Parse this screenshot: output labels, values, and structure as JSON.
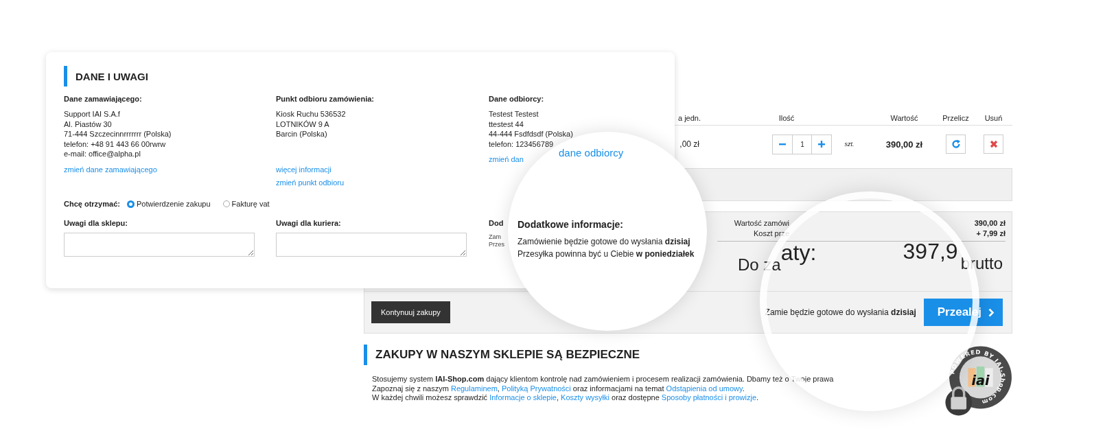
{
  "order_details": {
    "title": "DANE I UWAGI",
    "columns": [
      {
        "heading": "Dane zamawiającego:",
        "lines": [
          "Support IAI S.A.f",
          "Al. Piastów 30",
          "71-444 Szczecinnrrrrrrr (Polska)",
          "telefon: +48 91 443 66 00rwrw",
          "e-mail: office@alpha.pl"
        ],
        "links": [
          "zmień dane zamawiającego"
        ]
      },
      {
        "heading": "Punkt odbioru zamówienia:",
        "lines": [
          "Kiosk Ruchu 536532",
          "LOTNIKÓW 9 A",
          "Barcin (Polska)"
        ],
        "links": [
          "więcej informacji",
          "zmień punkt odbioru"
        ]
      },
      {
        "heading": "Dane odbiorcy:",
        "lines": [
          "Testest Testest",
          "ttestest 44",
          "44-444 Fsdfdsdf (Polska)",
          "telefon: 123456789"
        ],
        "links": [
          "zmień dan"
        ]
      }
    ],
    "receive": {
      "label": "Chcę otrzymać:",
      "options": [
        {
          "label": "Potwierdzenie zakupu",
          "selected": true
        },
        {
          "label": "Fakturę vat",
          "selected": false
        }
      ]
    },
    "notes": [
      {
        "label": "Uwagi dla sklepu:"
      },
      {
        "label": "Uwagi dla kuriera:"
      }
    ],
    "extra": {
      "heading": "Dod",
      "lines": [
        "Zam",
        "Przes"
      ]
    }
  },
  "cart": {
    "columns": [
      "a jedn.",
      "Ilość",
      "Wartość",
      "Przelicz",
      "Usuń"
    ],
    "row": {
      "unit_price": ",00 zł",
      "quantity": "1",
      "unit": "szt.",
      "value": "390,00 zł"
    }
  },
  "summary": {
    "rows": [
      {
        "label": "Wartość zamówi",
        "value": "390,00 zł"
      },
      {
        "label": "Koszt prze",
        "value": "+ 7,99 zł"
      }
    ],
    "total_label": [
      "Do za",
      "aty:"
    ],
    "total_value": "397,9",
    "total_suffix": "brutto"
  },
  "actions": {
    "continue": "Kontynuuj zakupy",
    "ready_note": "Zamie będzie gotowe do wysłania **dzisiaj**",
    "next": "Przealej"
  },
  "security": {
    "title": "ZAKUPY W NASZYM SKLEPIE SĄ BEZPIECZNE",
    "lines": [
      [
        {
          "kind": "text",
          "text": "Stosujemy system **IAI-Shop.com** dający klientom kontrolę nad zamówieniem i procesem realizacji zamówienia. Dbamy też o Twoje prawa"
        }
      ],
      [
        {
          "kind": "text",
          "text": "Zapoznaj się z naszym "
        },
        {
          "kind": "link",
          "text": "Regulaminem"
        },
        {
          "kind": "text",
          "text": ", "
        },
        {
          "kind": "link",
          "text": "Polityką Prywatności"
        },
        {
          "kind": "text",
          "text": " oraz informacjami na temat "
        },
        {
          "kind": "link",
          "text": "Odstąpienia od umowy"
        },
        {
          "kind": "text",
          "text": "."
        }
      ],
      [
        {
          "kind": "text",
          "text": "W każdej chwili możesz sprawdzić "
        },
        {
          "kind": "link",
          "text": "Informacje o sklepie"
        },
        {
          "kind": "text",
          "text": ", "
        },
        {
          "kind": "link",
          "text": "Koszty wysyłki"
        },
        {
          "kind": "text",
          "text": " oraz dostępne "
        },
        {
          "kind": "link",
          "text": "Sposoby płatności i prowizje"
        },
        {
          "kind": "text",
          "text": "."
        }
      ]
    ]
  },
  "magnifier": {
    "link": "dane odbiorcy",
    "heading": "Dodatkowe informacje:",
    "lines": [
      "Zamówienie będzie gotowe do wysłania **dzisiaj**",
      "Przesyłka powinna być u Ciebie **w poniedziałek**"
    ]
  },
  "badge": {
    "ring_text": "POWERED BY IAI-Shop.com",
    "logo": "iai"
  }
}
